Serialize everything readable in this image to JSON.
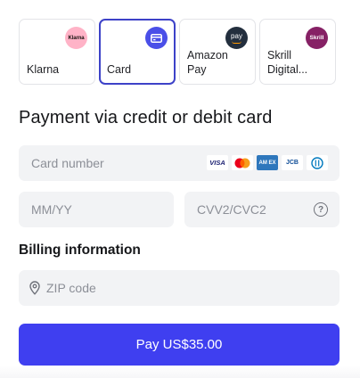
{
  "payment_methods": [
    {
      "label_lines": [
        "Klarna"
      ],
      "badge_text": "Klarna",
      "selected": false
    },
    {
      "label_lines": [
        "Card"
      ],
      "badge_text": "",
      "selected": true
    },
    {
      "label_lines": [
        "Amazon",
        "Pay"
      ],
      "badge_text": "pay",
      "selected": false
    },
    {
      "label_lines": [
        "Skrill",
        "Digital..."
      ],
      "badge_text": "Skrill",
      "selected": false
    }
  ],
  "card_section": {
    "title": "Payment via credit or debit card",
    "card_number_placeholder": "Card number",
    "card_brands": {
      "visa": "VISA",
      "amex": "AM EX",
      "jcb": "JCB"
    },
    "expiry_placeholder": "MM/YY",
    "cvv_placeholder": "CVV2/CVC2",
    "cvv_help_glyph": "?"
  },
  "billing": {
    "title": "Billing information",
    "zip_placeholder": "ZIP code"
  },
  "pay_button": {
    "label": "Pay US$35.00"
  },
  "colors": {
    "accent": "#3f3ff0",
    "selected_border": "#3d42c8",
    "field_bg": "#f2f3f5"
  }
}
